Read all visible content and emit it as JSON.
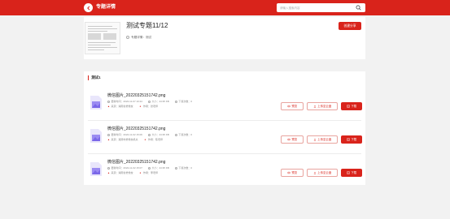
{
  "header": {
    "title": "专题详情",
    "search_placeholder": "请输入搜索内容"
  },
  "topic": {
    "title": "测试专题11/12",
    "intro_label": "专题详情：测试",
    "share_label": "创建分享"
  },
  "section": {
    "title": "测试1"
  },
  "files": [
    {
      "name": "微信图片_20220325151742.png",
      "date": "更新时间：2022-11-07 10:24",
      "size": "大小：44.95 KB",
      "downloads": "下载次数：0",
      "source": "来源：湖南省委党校",
      "author": "作者：张老师"
    },
    {
      "name": "微信图片_20220325151742.png",
      "date": "更新时间：2022-11-02 15:06",
      "size": "大小：44.95 KB",
      "downloads": "下载次数：0",
      "source": "来源：湘潭市委党校机关",
      "author": "作者：陈老师"
    },
    {
      "name": "微信图片_20220325151742.png",
      "date": "更新时间：2022-11-02 15:07",
      "size": "大小：44.95 KB",
      "downloads": "下载次数：0",
      "source": "来源：湖南省委党校",
      "author": "作者：李老师"
    }
  ],
  "actions": {
    "preview": "预览",
    "cloud": "上传至云盘",
    "download": "下载"
  },
  "colors": {
    "brand": "#d9231b",
    "file_icon": "#9b8bf2"
  }
}
